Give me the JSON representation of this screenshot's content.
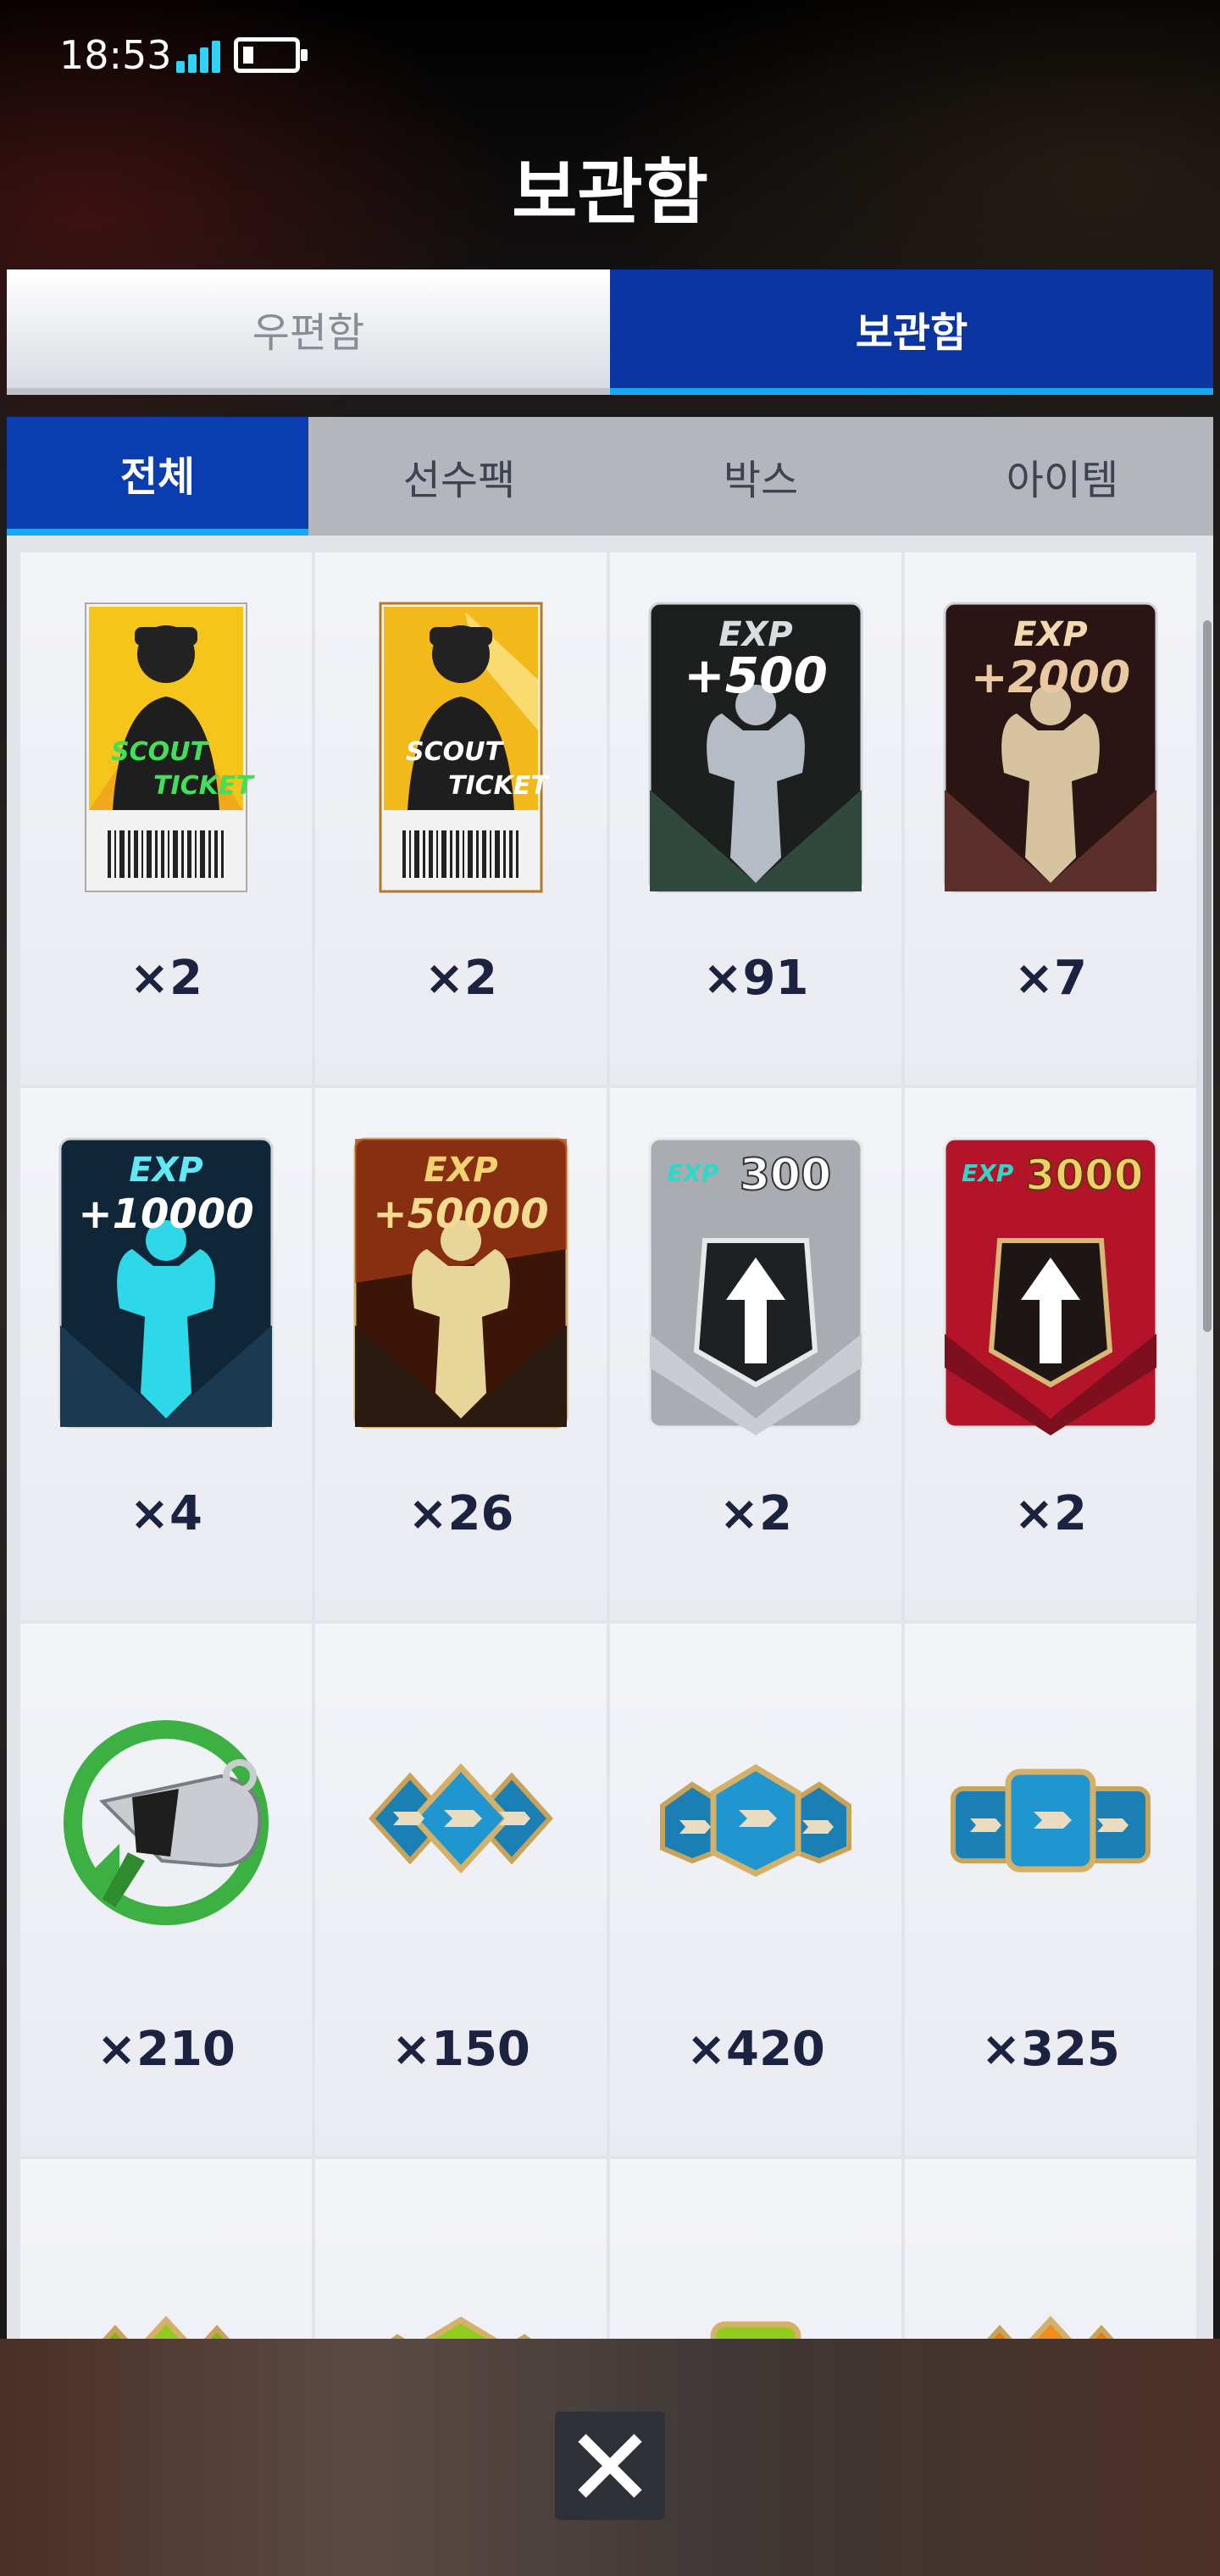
{
  "status_bar": {
    "time": "18:53",
    "signal_icon": "signal-bars-icon",
    "battery_icon": "battery-icon"
  },
  "title": "보관함",
  "top_tabs": [
    {
      "label": "우편함",
      "active": false
    },
    {
      "label": "보관함",
      "active": true
    }
  ],
  "sub_tabs": [
    {
      "label": "전체",
      "active": true
    },
    {
      "label": "선수팩",
      "active": false
    },
    {
      "label": "박스",
      "active": false
    },
    {
      "label": "아이템",
      "active": false
    }
  ],
  "items": [
    {
      "icon": "scout-ticket-gold-icon",
      "text": "SCOUT TICKET",
      "count": "×2"
    },
    {
      "icon": "scout-ticket-premium-icon",
      "text": "SCOUT TICKET",
      "count": "×2"
    },
    {
      "icon": "exp-card-500-icon",
      "text": "EXP",
      "value": "+500",
      "count": "×91"
    },
    {
      "icon": "exp-card-2000-icon",
      "text": "EXP",
      "value": "+2000",
      "count": "×7"
    },
    {
      "icon": "exp-card-10000-icon",
      "text": "EXP",
      "value": "+10000",
      "count": "×4"
    },
    {
      "icon": "exp-card-50000-icon",
      "text": "EXP",
      "value": "+50000",
      "count": "×26"
    },
    {
      "icon": "exp-upgrade-300-icon",
      "text": "EXP",
      "value": "300",
      "count": "×2"
    },
    {
      "icon": "exp-upgrade-3000-icon",
      "text": "EXP",
      "value": "3000",
      "count": "×2"
    },
    {
      "icon": "coach-whistle-icon",
      "count": "×210"
    },
    {
      "icon": "blue-badge-pack-icon",
      "count": "×150"
    },
    {
      "icon": "blue-badge-pack-icon",
      "count": "×420"
    },
    {
      "icon": "blue-badge-pack-icon",
      "count": "×325"
    },
    {
      "icon": "green-badge-pack-icon",
      "count": ""
    },
    {
      "icon": "green-badge-pack-icon",
      "count": ""
    },
    {
      "icon": "green-badge-pack-icon",
      "count": ""
    },
    {
      "icon": "orange-badge-pack-icon",
      "count": ""
    }
  ],
  "close_icon": "close-icon",
  "colors": {
    "tab_active": "#0a35a0",
    "tab_underline": "#18a8f0",
    "count_text": "#1c2340"
  }
}
